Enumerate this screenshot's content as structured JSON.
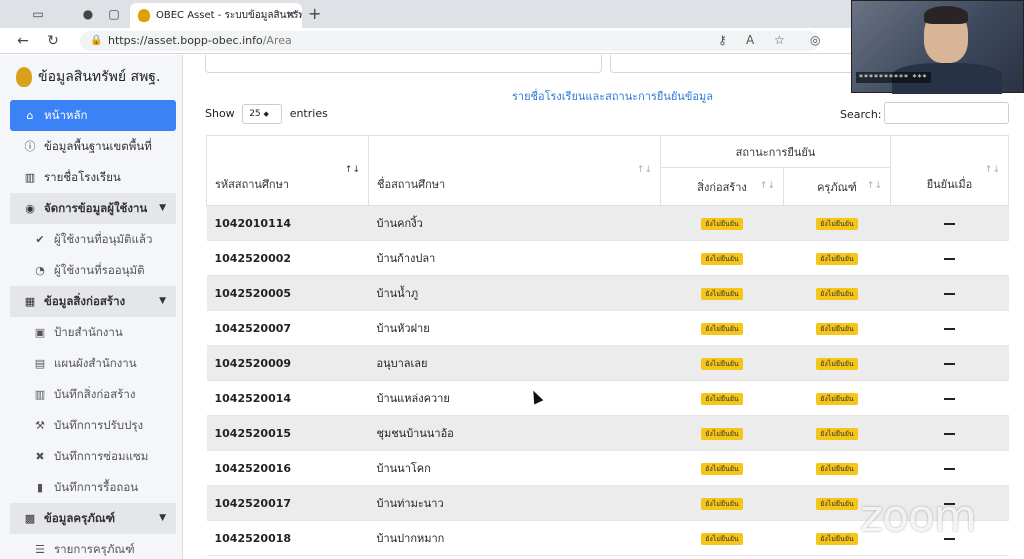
{
  "browser": {
    "tab_title": "OBEC Asset - ระบบข้อมูลสินทรัพ",
    "url_host": "https://asset.bopp-obec.info",
    "url_path": "/Area"
  },
  "sidebar": {
    "brand": "ข้อมูลสินทรัพย์ สพฐ.",
    "items": [
      {
        "label": "หน้าหลัก",
        "icon": "home-icon"
      },
      {
        "label": "ข้อมูลพื้นฐานเขตพื้นที่",
        "icon": "info-icon"
      },
      {
        "label": "รายชื่อโรงเรียน",
        "icon": "school-icon"
      },
      {
        "label": "จัดการข้อมูลผู้ใช้งาน",
        "icon": "users-icon"
      },
      {
        "label": "ผู้ใช้งานที่อนุมัติแล้ว",
        "icon": "user-check-icon"
      },
      {
        "label": "ผู้ใช้งานที่รออนุมัติ",
        "icon": "user-clock-icon"
      },
      {
        "label": "ข้อมูลสิ่งก่อสร้าง",
        "icon": "building-icon"
      },
      {
        "label": "ป้ายสำนักงาน",
        "icon": "sign-icon"
      },
      {
        "label": "แผนผังสำนักงาน",
        "icon": "map-icon"
      },
      {
        "label": "บันทึกสิ่งก่อสร้าง",
        "icon": "school-icon"
      },
      {
        "label": "บันทึกการปรับปรุง",
        "icon": "hammer-icon"
      },
      {
        "label": "บันทึกการซ่อมแซม",
        "icon": "tools-icon"
      },
      {
        "label": "บันทึกการรื้อถอน",
        "icon": "trash-icon"
      },
      {
        "label": "ข้อมูลครุภัณฑ์",
        "icon": "print-icon"
      },
      {
        "label": "รายการครุภัณฑ์",
        "icon": "list-icon"
      }
    ]
  },
  "main": {
    "page_link": "รายชื่อโรงเรียนและสถานะการยืนยันข้อมูล",
    "show_label": "Show",
    "entries_value": "25",
    "entries_label": "entries",
    "search_label": "Search:",
    "columns": {
      "code": "รหัสสถานศึกษา",
      "name": "ชื่อสถานศึกษา",
      "status_group": "สถานะการยืนยัน",
      "building": "สิ่งก่อสร้าง",
      "equipment": "ครุภัณฑ์",
      "confirmed_at": "ยืนยันเมื่อ"
    },
    "badge_text": "ยังไม่ยืนยัน",
    "rows": [
      {
        "code": "1042010114",
        "name": "บ้านคกงิ้ว"
      },
      {
        "code": "1042520002",
        "name": "บ้านก้างปลา"
      },
      {
        "code": "1042520005",
        "name": "บ้านน้ำภู"
      },
      {
        "code": "1042520007",
        "name": "บ้านหัวฝาย"
      },
      {
        "code": "1042520009",
        "name": "อนุบาลเลย"
      },
      {
        "code": "1042520014",
        "name": "บ้านแหล่งควาย"
      },
      {
        "code": "1042520015",
        "name": "ชุมชนบ้านนาอ้อ"
      },
      {
        "code": "1042520016",
        "name": "บ้านนาโคก"
      },
      {
        "code": "1042520017",
        "name": "บ้านท่ามะนาว"
      },
      {
        "code": "1042520018",
        "name": "บ้านปากหมาก"
      }
    ]
  },
  "overlay": {
    "participant_name": "********** ***",
    "zoom_watermark": "zoom"
  },
  "colors": {
    "accent": "#3b82f6",
    "badge": "#f5c518",
    "link": "#2b7bd6"
  }
}
